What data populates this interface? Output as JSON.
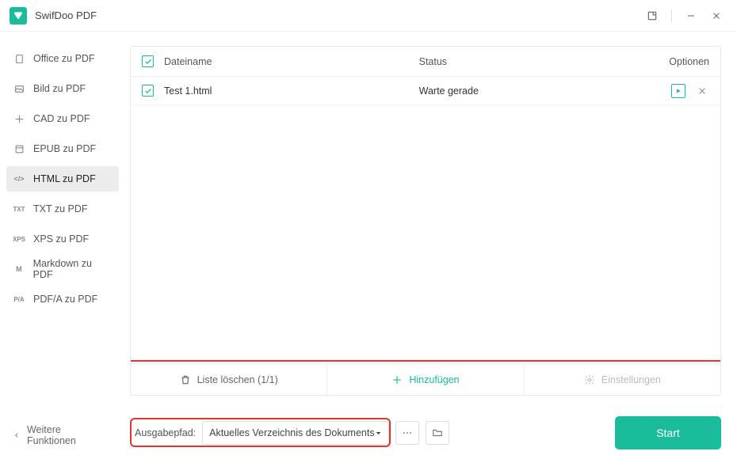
{
  "app": {
    "title": "SwifDoo PDF"
  },
  "sidebar": {
    "items": [
      {
        "label": "Office zu PDF",
        "icon": "doc-icon"
      },
      {
        "label": "Bild zu PDF",
        "icon": "image-icon"
      },
      {
        "label": "CAD zu PDF",
        "icon": "cad-icon"
      },
      {
        "label": "EPUB zu PDF",
        "icon": "epub-icon"
      },
      {
        "label": "HTML zu PDF",
        "icon": "html-icon"
      },
      {
        "label": "TXT zu PDF",
        "icon": "txt-icon"
      },
      {
        "label": "XPS zu PDF",
        "icon": "xps-icon"
      },
      {
        "label": "Markdown zu PDF",
        "icon": "markdown-icon"
      },
      {
        "label": "PDF/A zu PDF",
        "icon": "pdfa-icon"
      }
    ],
    "active_index": 4,
    "more_label": "Weitere Funktionen"
  },
  "table": {
    "headers": {
      "checkbox": true,
      "name": "Dateiname",
      "status": "Status",
      "options": "Optionen"
    },
    "rows": [
      {
        "checked": true,
        "name": "Test 1.html",
        "status": "Warte gerade"
      }
    ],
    "footer": {
      "clear": "Liste löschen (1/1)",
      "add": "Hinzufügen",
      "settings": "Einstellungen"
    }
  },
  "output": {
    "label": "Ausgabepfad:",
    "selected": "Aktuelles Verzeichnis des Dokuments"
  },
  "start_label": "Start",
  "icon_text": {
    "doc": "▭",
    "image": "▲",
    "cad": "⊹",
    "epub": "⧉",
    "html": "</>",
    "txt": "TXT",
    "xps": "XPS",
    "md": "M",
    "pdfa": "P/A"
  }
}
